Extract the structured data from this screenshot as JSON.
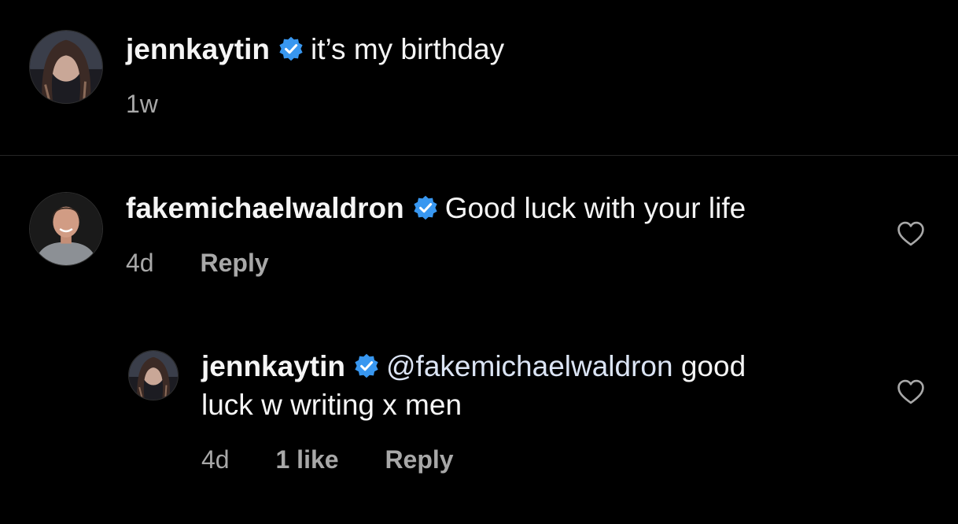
{
  "caption": {
    "username": "jennkaytin",
    "text": "it’s my birthday",
    "time": "1w"
  },
  "comments": [
    {
      "username": "fakemichaelwaldron",
      "text": "Good luck with your life",
      "time": "4d",
      "reply_label": "Reply"
    }
  ],
  "replies": [
    {
      "username": "jennkaytin",
      "mention": "@fakemichaelwaldron",
      "text_line1": "good",
      "text_line2": "luck w writing x men",
      "time": "4d",
      "likes": "1 like",
      "reply_label": "Reply"
    }
  ],
  "colors": {
    "background": "#000000",
    "text": "#f5f5f5",
    "secondary_text": "#a8a8a8",
    "mention": "#dbe4f4",
    "verified_badge": "#3897f0",
    "divider": "#262626"
  },
  "icons": {
    "verified": "verified-badge-icon",
    "like": "heart-outline-icon"
  }
}
